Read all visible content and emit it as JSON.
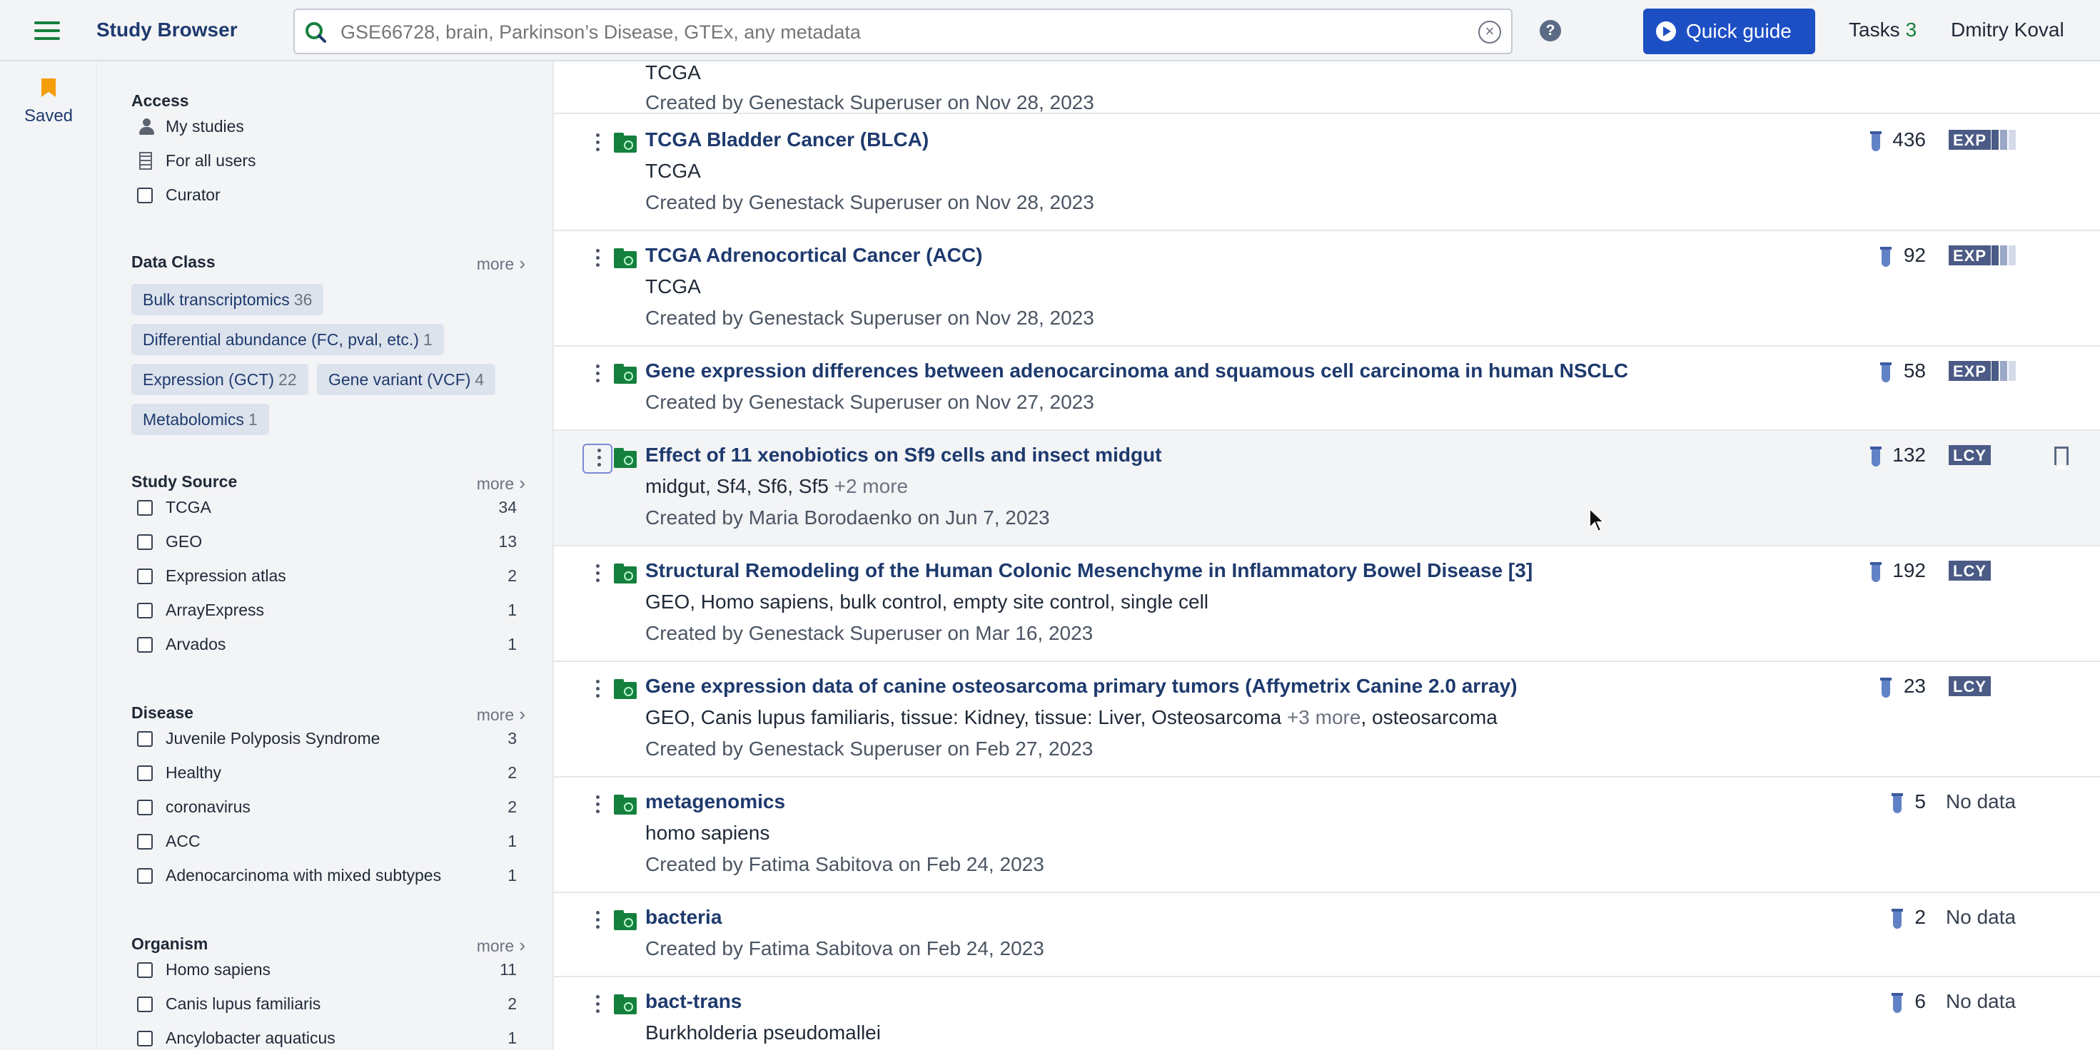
{
  "header": {
    "app_title": "Study Browser",
    "search_placeholder": "GSE66728, brain, Parkinson’s Disease, GTEx, any metadata",
    "quick_guide_label": "Quick guide",
    "tasks_label": "Tasks",
    "tasks_count": "3",
    "user_name": "Dmitry Koval",
    "help_glyph": "?",
    "clear_glyph": "×"
  },
  "rail": {
    "saved_label": "Saved"
  },
  "filters": {
    "more_label": "more",
    "access": {
      "title": "Access",
      "items": [
        {
          "label": "My studies",
          "icon": "user-icon"
        },
        {
          "label": "For all users",
          "icon": "building-icon"
        },
        {
          "label": "Curator",
          "icon": "checkbox"
        }
      ]
    },
    "data_class": {
      "title": "Data Class",
      "tags": [
        {
          "label": "Bulk transcriptomics",
          "count": "36"
        },
        {
          "label": "Differential abundance (FC, pval, etc.)",
          "count": "1"
        },
        {
          "label": "Expression (GCT)",
          "count": "22"
        },
        {
          "label": "Gene variant (VCF)",
          "count": "4"
        },
        {
          "label": "Metabolomics",
          "count": "1"
        }
      ]
    },
    "study_source": {
      "title": "Study Source",
      "items": [
        {
          "label": "TCGA",
          "count": "34"
        },
        {
          "label": "GEO",
          "count": "13"
        },
        {
          "label": "Expression atlas",
          "count": "2"
        },
        {
          "label": "ArrayExpress",
          "count": "1"
        },
        {
          "label": "Arvados",
          "count": "1"
        }
      ]
    },
    "disease": {
      "title": "Disease",
      "items": [
        {
          "label": "Juvenile Polyposis Syndrome",
          "count": "3"
        },
        {
          "label": "Healthy",
          "count": "2"
        },
        {
          "label": "coronavirus",
          "count": "2"
        },
        {
          "label": "ACC",
          "count": "1"
        },
        {
          "label": "Adenocarcinoma with mixed subtypes",
          "count": "1"
        }
      ]
    },
    "organism": {
      "title": "Organism",
      "items": [
        {
          "label": "Homo sapiens",
          "count": "11"
        },
        {
          "label": "Canis lupus familiaris",
          "count": "2"
        },
        {
          "label": "Ancylobacter aquaticus",
          "count": "1"
        }
      ]
    }
  },
  "studies": [
    {
      "title": "",
      "line": "TCGA",
      "meta": "Created by Genestack Superuser on Nov 28, 2023"
    },
    {
      "title": "TCGA Bladder Cancer (BLCA)",
      "line": "TCGA",
      "meta": "Created by Genestack Superuser on Nov 28, 2023",
      "samples": "436",
      "badge": "EXP"
    },
    {
      "title": "TCGA Adrenocortical Cancer (ACC)",
      "line": "TCGA",
      "meta": "Created by Genestack Superuser on Nov 28, 2023",
      "samples": "92",
      "badge": "EXP"
    },
    {
      "title": "Gene expression differences between adenocarcinoma and squamous cell carcinoma in human NSCLC",
      "meta": "Created by Genestack Superuser on Nov 27, 2023",
      "samples": "58",
      "badge": "EXP"
    },
    {
      "title": "Effect of 11 xenobiotics on Sf9 cells and insect midgut",
      "line": "midgut, Sf4, Sf6, Sf5",
      "line_more": "+2 more",
      "meta": "Created by Maria Borodaenko on Jun 7, 2023",
      "samples": "132",
      "badge": "LCY"
    },
    {
      "title": "Structural Remodeling of the Human Colonic Mesenchyme in Inflammatory Bowel Disease [3]",
      "line": "GEO, Homo sapiens, bulk control, empty site control, single cell",
      "meta": "Created by Genestack Superuser on Mar 16, 2023",
      "samples": "192",
      "badge": "LCY"
    },
    {
      "title": "Gene expression data of canine osteosarcoma primary tumors (Affymetrix Canine 2.0 array)",
      "line": "GEO, Canis lupus familiaris, tissue: Kidney, tissue: Liver, Osteosarcoma",
      "line_more": "+3 more",
      "line_tail": ", osteosarcoma",
      "meta": "Created by Genestack Superuser on Feb 27, 2023",
      "samples": "23",
      "badge": "LCY"
    },
    {
      "title": "metagenomics",
      "line": "homo sapiens",
      "meta": "Created by Fatima Sabitova on Feb 24, 2023",
      "samples": "5",
      "status": "No data"
    },
    {
      "title": "bacteria",
      "meta": "Created by Fatima Sabitova on Feb 24, 2023",
      "samples": "2",
      "status": "No data"
    },
    {
      "title": "bact-trans",
      "line": "Burkholderia pseudomallei",
      "samples": "6",
      "status": "No data"
    }
  ],
  "colors": {
    "accent_blue": "#1d4fc4",
    "title_navy": "#1e3a6e",
    "folder_green": "#15803d",
    "badge_slate": "#4b5b86",
    "saved_orange": "#f59e0b"
  }
}
